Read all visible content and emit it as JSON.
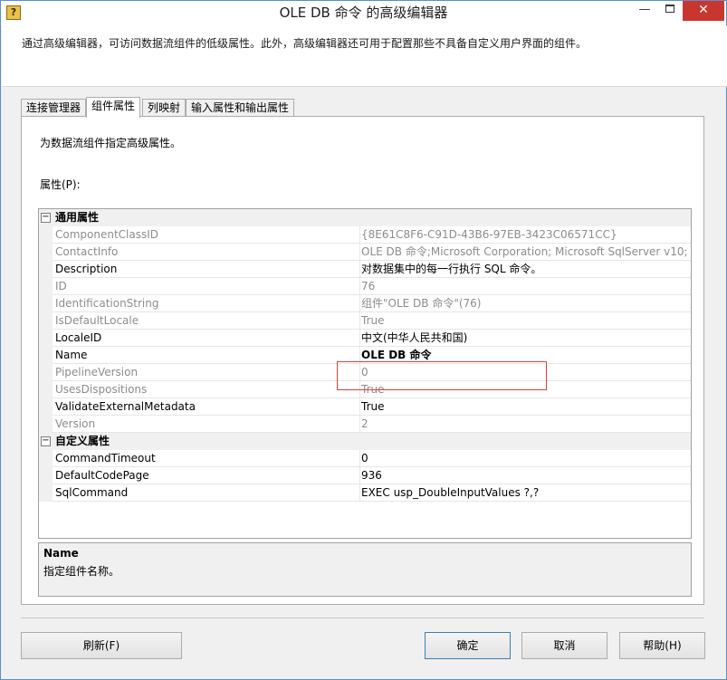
{
  "window": {
    "title": "OLE DB 命令 的高级编辑器",
    "app_icon": "?",
    "close_glyph": "✕",
    "minimize_glyph": "—"
  },
  "header": {
    "description": "通过高级编辑器，可访问数据流组件的低级属性。此外，高级编辑器还可用于配置那些不具备自定义用户界面的组件。"
  },
  "tabs": [
    {
      "label": "连接管理器"
    },
    {
      "label": "组件属性",
      "active": true
    },
    {
      "label": "列映射"
    },
    {
      "label": "输入属性和输出属性"
    }
  ],
  "panel": {
    "description": "为数据流组件指定高级属性。",
    "properties_label": "属性(P):"
  },
  "grid": {
    "categories": [
      {
        "toggle": "⊟",
        "label": "通用属性",
        "rows": [
          {
            "name": "ComponentClassID",
            "value": "{8E61C8F6-C91D-43B6-97EB-3423C06571CC}",
            "readonly": true
          },
          {
            "name": "ContactInfo",
            "value": "OLE DB 命令;Microsoft Corporation; Microsoft SqlServer v10; (",
            "readonly": true
          },
          {
            "name": "Description",
            "value": "对数据集中的每一行执行 SQL 命令。",
            "readonly": false
          },
          {
            "name": "ID",
            "value": "76",
            "readonly": true
          },
          {
            "name": "IdentificationString",
            "value": "组件\"OLE DB 命令\"(76)",
            "readonly": true
          },
          {
            "name": "IsDefaultLocale",
            "value": "True",
            "readonly": true
          },
          {
            "name": "LocaleID",
            "value": "中文(中华人民共和国)",
            "readonly": false
          },
          {
            "name": "Name",
            "value": "OLE DB 命令",
            "readonly": false,
            "bold": true
          },
          {
            "name": "PipelineVersion",
            "value": "0",
            "readonly": true
          },
          {
            "name": "UsesDispositions",
            "value": "True",
            "readonly": true
          },
          {
            "name": "ValidateExternalMetadata",
            "value": "True",
            "readonly": false
          },
          {
            "name": "Version",
            "value": "2",
            "readonly": true
          }
        ]
      },
      {
        "toggle": "⊟",
        "label": "自定义属性",
        "rows": [
          {
            "name": "CommandTimeout",
            "value": "0",
            "readonly": false
          },
          {
            "name": "DefaultCodePage",
            "value": "936",
            "readonly": false
          },
          {
            "name": "SqlCommand",
            "value": "EXEC usp_DoubleInputValues ?,?",
            "readonly": false
          }
        ]
      }
    ]
  },
  "help": {
    "title": "Name",
    "text": "指定组件名称。"
  },
  "buttons": {
    "refresh": "刷新(F)",
    "ok": "确定",
    "cancel": "取消",
    "help": "帮助(H)"
  },
  "colors": {
    "accent_border": "#5a8ecb",
    "close_button": "#c7372f",
    "highlight_box": "#e03c3c"
  }
}
